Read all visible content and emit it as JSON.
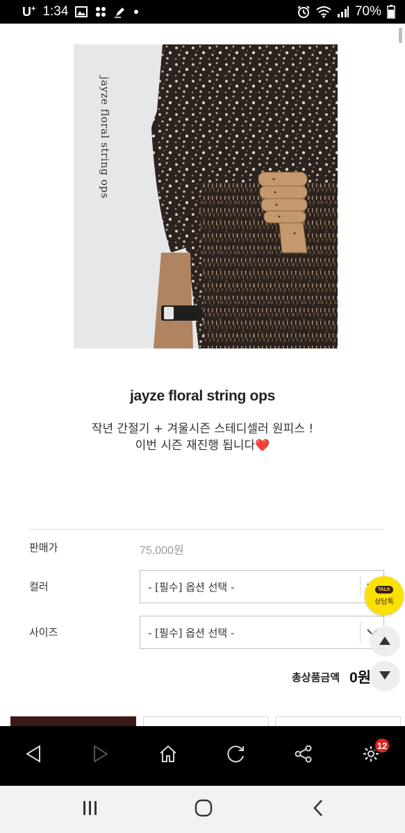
{
  "status_bar": {
    "carrier": "U",
    "carrier_sup": "+",
    "time": "1:34",
    "battery": "70%"
  },
  "product": {
    "image_caption": "jayze floral string ops",
    "title": "jayze floral string ops",
    "desc_line1": "작년 간절기 + 겨울시즌 스테디셀러 원피스 !",
    "desc_line2": "이번 시즌 재진행 됩니다",
    "heart": "❤️"
  },
  "options": {
    "price_label": "판매가",
    "price_value": "75,000원",
    "color_label": "컬러",
    "color_select": "- [필수] 옵션 선택 -",
    "size_label": "사이즈",
    "size_select": "- [필수] 옵션 선택 -",
    "total_label": "총상품금액",
    "total_value": "0원"
  },
  "floating": {
    "talk_bubble": "TALK",
    "talk_label": "상담톡",
    "scroll_up": "up-arrow-icon",
    "scroll_down": "down-arrow-icon"
  },
  "browser_toolbar": {
    "back": "back-triangle-icon",
    "forward": "forward-triangle-icon",
    "home": "home-icon",
    "refresh": "refresh-icon",
    "share": "share-icon",
    "settings": "settings-gear-icon",
    "settings_badge": "12"
  },
  "navigation_bar": {
    "recents": "recents-icon",
    "home": "home-circle-icon",
    "back": "back-chevron-icon"
  },
  "colors": {
    "kakao_yellow": "#fae100",
    "badge_red": "#e02424",
    "heart_red": "#e0202a",
    "dark_button": "#3b1a1a"
  }
}
